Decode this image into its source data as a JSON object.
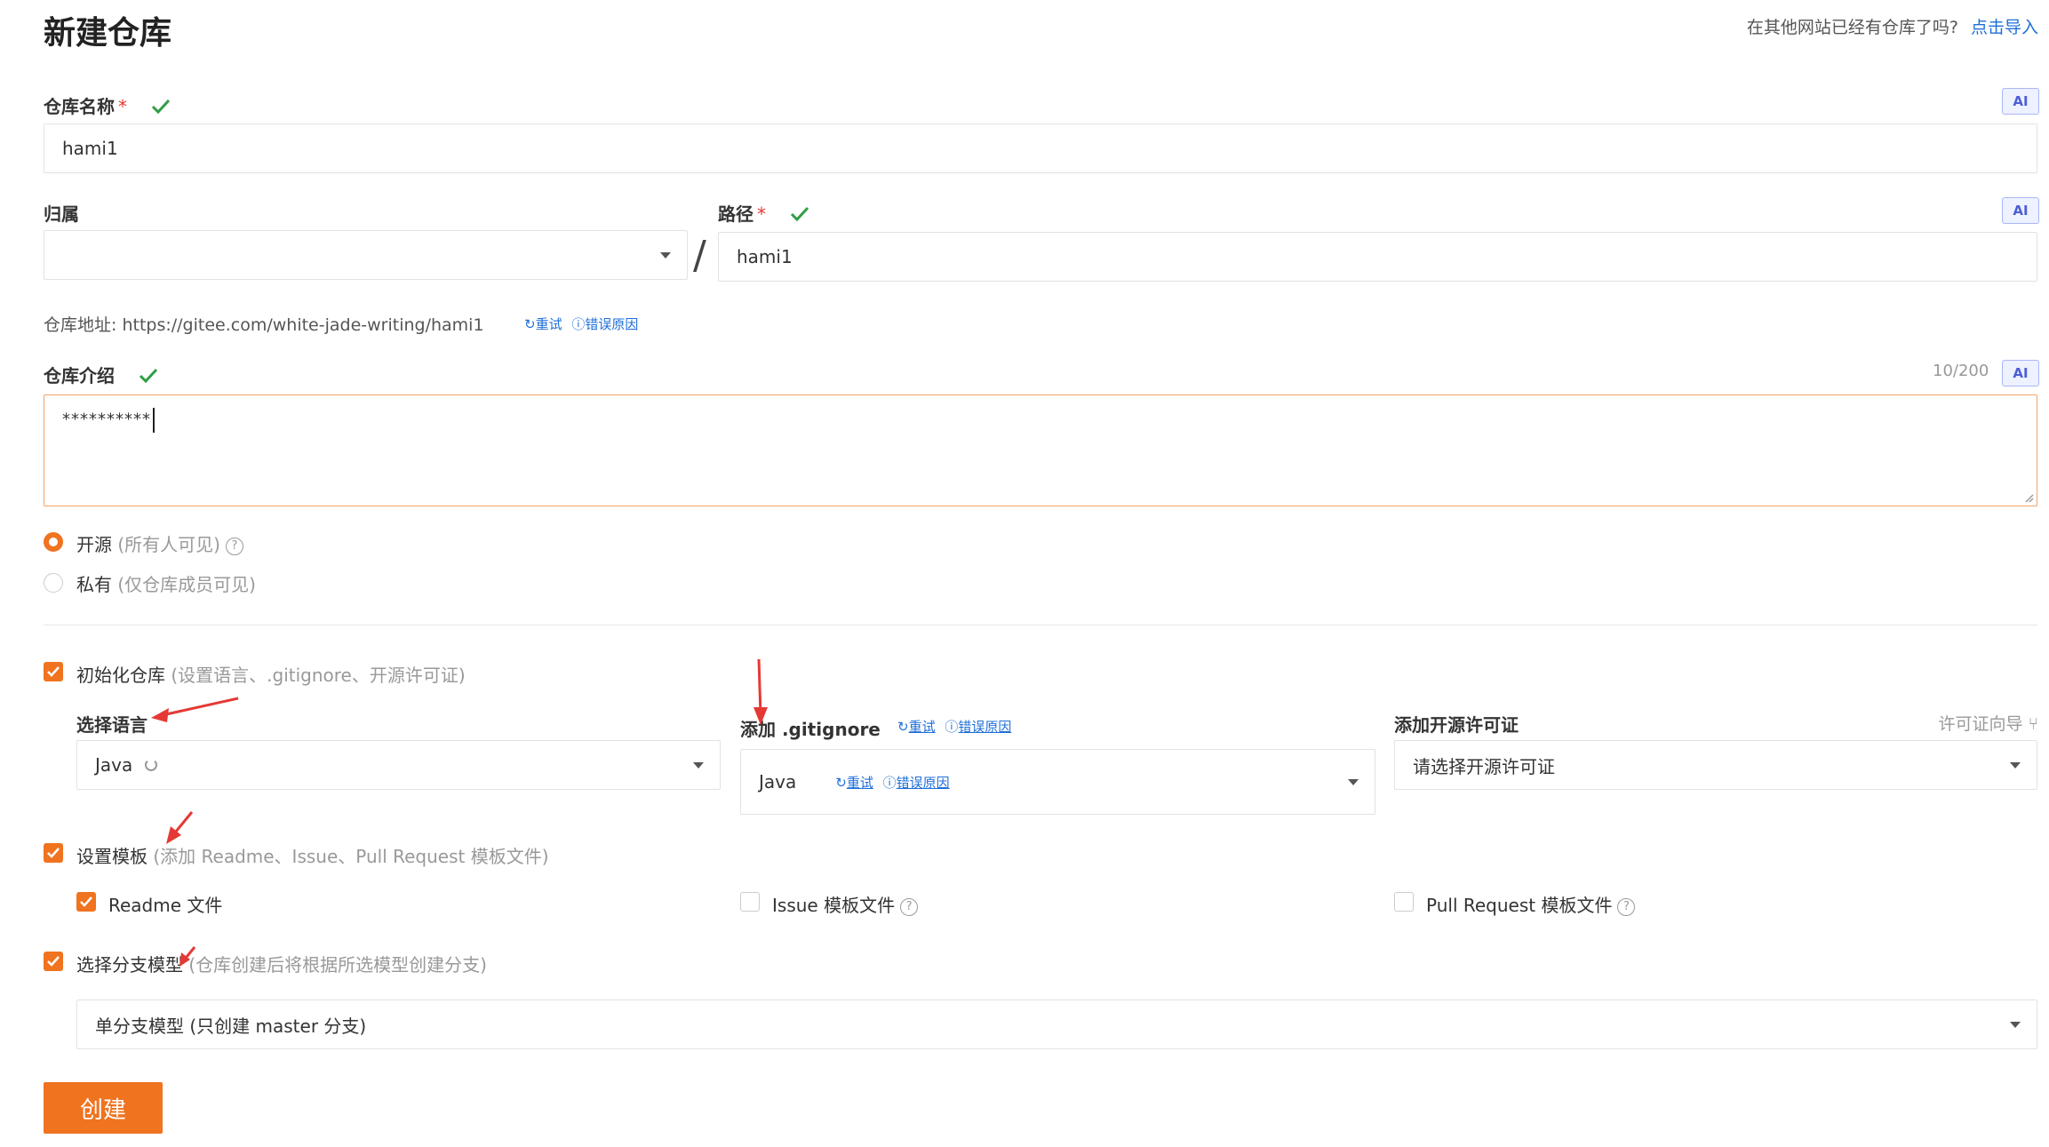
{
  "header": {
    "title": "新建仓库",
    "import_hint": "在其他网站已经有仓库了吗?",
    "import_link": "点击导入"
  },
  "fields": {
    "repo_name": {
      "label": "仓库名称",
      "required": "*",
      "value": "hami1",
      "ai": "AI"
    },
    "owner": {
      "label": "归属"
    },
    "path": {
      "label": "路径",
      "required": "*",
      "value": "hami1",
      "ai": "AI"
    },
    "address": {
      "label": "仓库地址:",
      "url": "https://gitee.com/white-jade-writing/hami1",
      "retry": "重试",
      "reason": "错误原因"
    },
    "description": {
      "label": "仓库介绍",
      "counter": "10/200",
      "ai": "AI",
      "value": "**********"
    }
  },
  "visibility": {
    "public": {
      "label": "开源",
      "hint": "(所有人可见)"
    },
    "private": {
      "label": "私有",
      "hint": "(仅仓库成员可见)"
    }
  },
  "init": {
    "label": "初始化仓库",
    "hint": "(设置语言、.gitignore、开源许可证)",
    "language": {
      "label": "选择语言",
      "value": "Java"
    },
    "gitignore": {
      "label": "添加 .gitignore",
      "retry": "重试",
      "reason": "错误原因",
      "value": "Java",
      "value_retry": "重试",
      "value_reason": "错误原因"
    },
    "license": {
      "label": "添加开源许可证",
      "guide": "许可证向导",
      "placeholder": "请选择开源许可证"
    }
  },
  "template": {
    "label": "设置模板",
    "hint": "(添加 Readme、Issue、Pull Request 模板文件)",
    "readme": "Readme 文件",
    "issue": "Issue 模板文件",
    "pr": "Pull Request 模板文件"
  },
  "branch": {
    "label": "选择分支模型",
    "hint": "(仓库创建后将根据所选模型创建分支)",
    "value": "单分支模型 (只创建 master 分支)"
  },
  "submit": {
    "label": "创建"
  },
  "colors": {
    "accent": "#f0731f",
    "link": "#1e6fd9",
    "success": "#2e9e44",
    "annotation": "#e53935"
  }
}
